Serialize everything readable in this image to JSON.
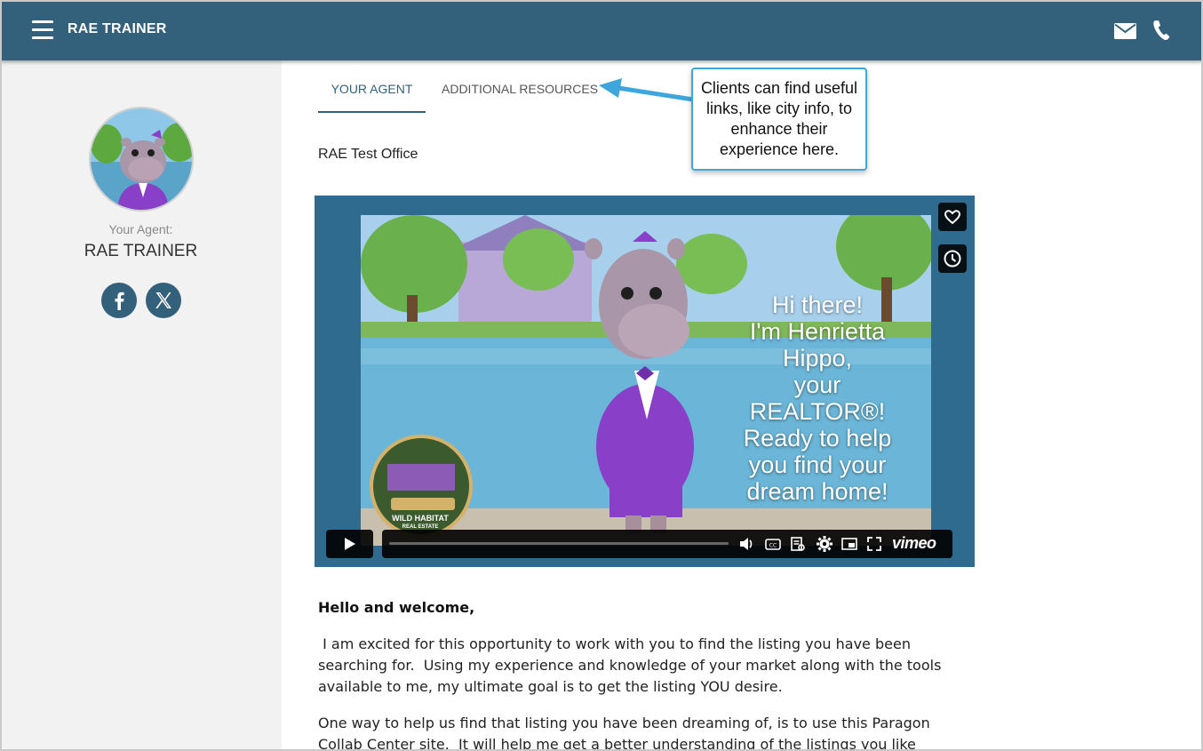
{
  "header": {
    "title": "RAE TRAINER",
    "menu_icon": "hamburger-menu-icon",
    "mail_icon": "envelope-icon",
    "phone_icon": "phone-icon"
  },
  "sidebar": {
    "agent_label": "Your Agent:",
    "agent_name": "RAE TRAINER",
    "social": [
      {
        "icon": "facebook-icon"
      },
      {
        "icon": "x-twitter-icon"
      }
    ]
  },
  "tabs": [
    {
      "label": "YOUR AGENT",
      "active": true
    },
    {
      "label": "ADDITIONAL RESOURCES",
      "active": false
    }
  ],
  "callout": {
    "text": "Clients can find useful links, like city info, to enhance their experience here."
  },
  "office_name": "RAE Test Office",
  "video": {
    "overlay_lines": [
      "Hi there!",
      "I'm Henrietta",
      "Hippo,",
      "your",
      "REALTOR®!",
      "Ready to help",
      "you find your",
      "dream home!"
    ],
    "logo_text": "WILD HABITAT",
    "logo_subtext": "REAL ESTATE",
    "player_brand": "vimeo"
  },
  "content": {
    "greeting": "Hello and welcome,",
    "paragraph1": " I am excited for this opportunity to work with you to find the listing you have been searching for.  Using my experience and knowledge of your market along with the tools available to me, my ultimate goal is to get the listing YOU desire.",
    "paragraph2": "One way to help us find that listing you have been dreaming of, is to use this Paragon Collab Center site.  It will help me get a better understanding of the listings you like"
  },
  "colors": {
    "header": "#33607a",
    "sidebar": "#f2f2f2",
    "callout_border": "#3ea6dc",
    "video_bg": "#2e6b8e"
  }
}
